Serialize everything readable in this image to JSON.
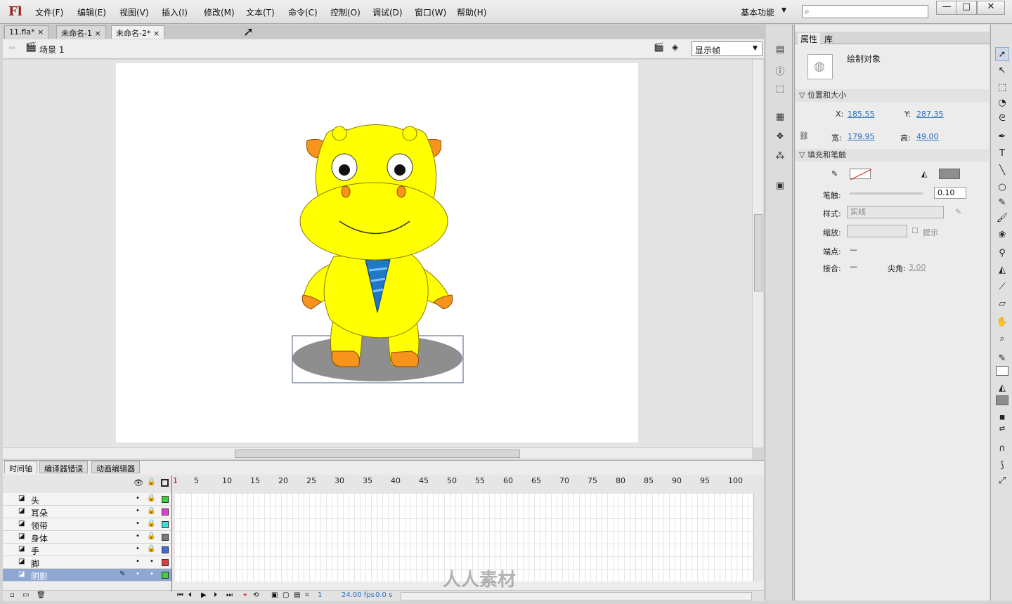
{
  "app": {
    "logo": "Fl"
  },
  "menu": [
    "文件(F)",
    "编辑(E)",
    "视图(V)",
    "插入(I)",
    "修改(M)",
    "文本(T)",
    "命令(C)",
    "控制(O)",
    "调试(D)",
    "窗口(W)",
    "帮助(H)"
  ],
  "workspace": "基本功能",
  "window_controls": {
    "min": "—",
    "max": "□",
    "close": "✕"
  },
  "tabs": [
    {
      "label": "11.fla*",
      "close": "×"
    },
    {
      "label": "未命名-1",
      "close": "×"
    },
    {
      "label": "未命名-2*",
      "close": "×"
    }
  ],
  "scene": {
    "name": "场景 1",
    "view_mode": "显示帧"
  },
  "properties": {
    "tabs": [
      "属性",
      "库"
    ],
    "object_type": "绘制对象",
    "section_position": "位置和大小",
    "x_label": "X:",
    "x": "185.55",
    "y_label": "Y:",
    "y": "287.35",
    "w_label": "宽:",
    "w": "179.95",
    "h_label": "高:",
    "h": "49.00",
    "section_fill": "填充和笔触",
    "stroke_label": "笔触:",
    "stroke_value": "0.10",
    "style_label": "样式:",
    "style_value": "实线",
    "scale_label": "缩放:",
    "hint_label": "提示",
    "cap_label": "端点:",
    "cap_value": "—",
    "join_label": "接合:",
    "join_value": "—",
    "miter_label": "尖角:",
    "miter_value": "3.00"
  },
  "timeline": {
    "tabs": [
      "时间轴",
      "编译器错误",
      "动画编辑器"
    ],
    "ruler": [
      "1",
      "5",
      "10",
      "15",
      "20",
      "25",
      "30",
      "35",
      "40",
      "45",
      "50",
      "55",
      "60",
      "65",
      "70",
      "75",
      "80",
      "85",
      "90",
      "95",
      "100"
    ],
    "layers": [
      {
        "name": "头",
        "color": "#3cd23c"
      },
      {
        "name": "耳朵",
        "color": "#e03ce0"
      },
      {
        "name": "领带",
        "color": "#3ce0e0"
      },
      {
        "name": "身体",
        "color": "#7a7a7a"
      },
      {
        "name": "手",
        "color": "#3c6ee0"
      },
      {
        "name": "脚",
        "color": "#e03c3c"
      },
      {
        "name": "阴影",
        "color": "#3cd23c"
      }
    ],
    "frame": "1",
    "fps": "24.00 fps",
    "time": "0.0 s"
  },
  "watermark": "人人素材",
  "colors": {
    "fill": "#8e8e8e",
    "body": "#ffff00",
    "accent": "#f7941d"
  }
}
